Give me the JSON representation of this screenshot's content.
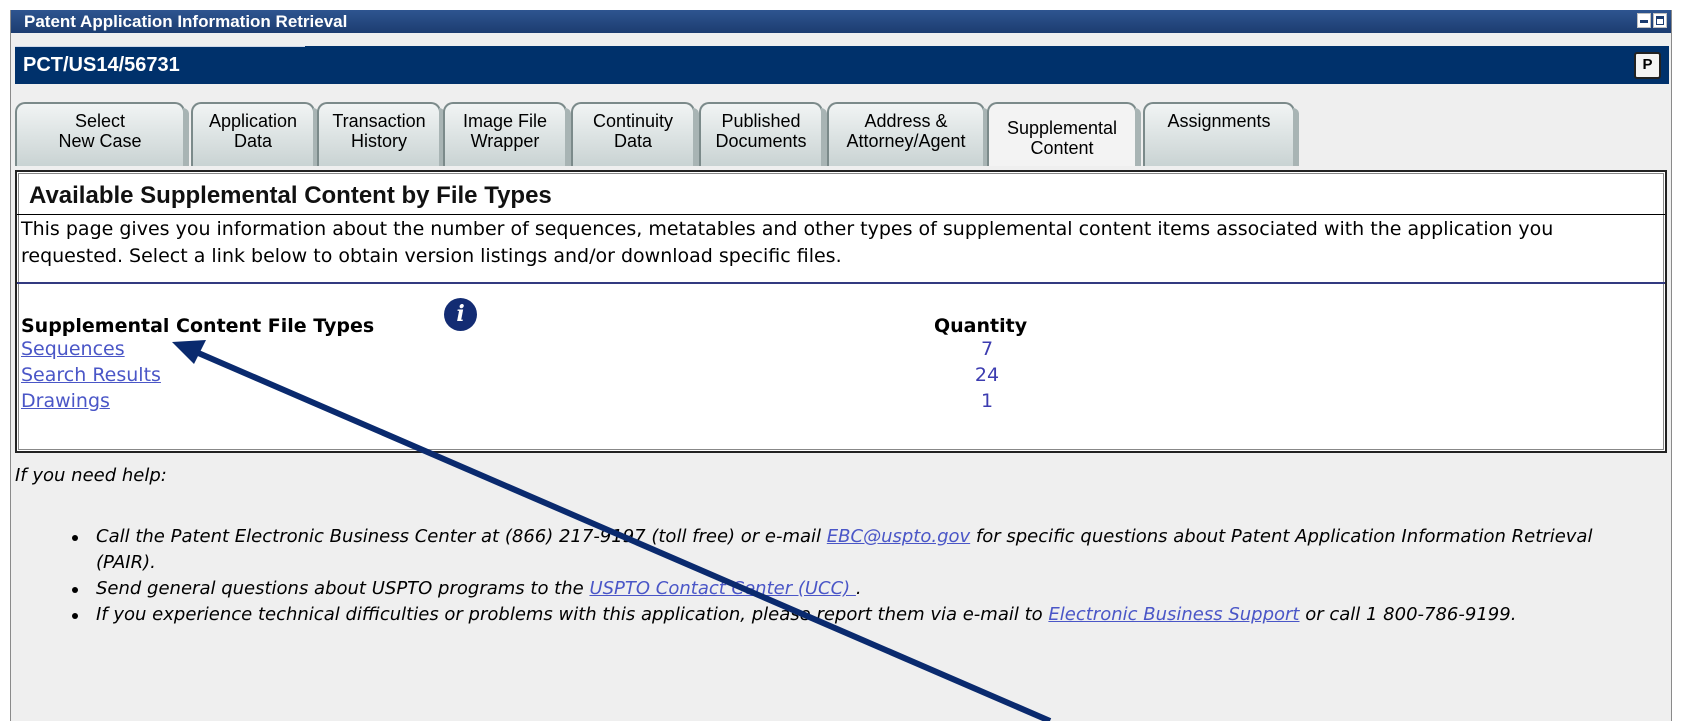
{
  "window": {
    "title": "Patent Application Information Retrieval"
  },
  "case": {
    "number": "PCT/US14/56731",
    "icon_glyph": "P"
  },
  "tabs": [
    {
      "line1": "Select",
      "line2": "New Case"
    },
    {
      "line1": "Application",
      "line2": "Data"
    },
    {
      "line1": "Transaction",
      "line2": "History"
    },
    {
      "line1": "Image File",
      "line2": "Wrapper"
    },
    {
      "line1": "Continuity",
      "line2": "Data"
    },
    {
      "line1": "Published",
      "line2": "Documents"
    },
    {
      "line1": "Address &",
      "line2": "Attorney/Agent"
    },
    {
      "line1": "Supplemental",
      "line2": "Content"
    },
    {
      "line1": "Assignments",
      "line2": ""
    }
  ],
  "active_tab": "Supplemental Content",
  "content": {
    "title": "Available Supplemental Content by File Types",
    "description": "This page gives you information about the number of sequences, metatables and other types of supplemental content items associated with the application you requested. Select a link below to obtain version listings and/or download specific files.",
    "types_header": "Supplemental Content File Types",
    "info_glyph": "i",
    "quantity_header": "Quantity",
    "file_types": [
      {
        "name": "Sequences",
        "quantity": "7"
      },
      {
        "name": "Search Results",
        "quantity": "24"
      },
      {
        "name": "Drawings",
        "quantity": "1"
      }
    ]
  },
  "help": {
    "label": "If you need help:",
    "item1_a": "Call the Patent Electronic Business Center at (866) 217-9197 (toll free) or e-mail ",
    "item1_link": "EBC@uspto.gov",
    "item1_b": " for specific questions about Patent Application Information Retrieval (PAIR).",
    "item2_a": "Send general questions about USPTO programs to the ",
    "item2_link": "USPTO Contact Center (UCC) ",
    "item2_b": ".",
    "item3_a": "If you experience technical difficulties or problems with this application, please report them via e-mail to ",
    "item3_link": "Electronic Business Support",
    "item3_b": " or call 1 800-786-9199."
  },
  "colors": {
    "title_bar": "#1c3c70",
    "case_bar": "#00316b",
    "link": "#4a56c7",
    "annotation_arrow": "#0a2a6e"
  }
}
